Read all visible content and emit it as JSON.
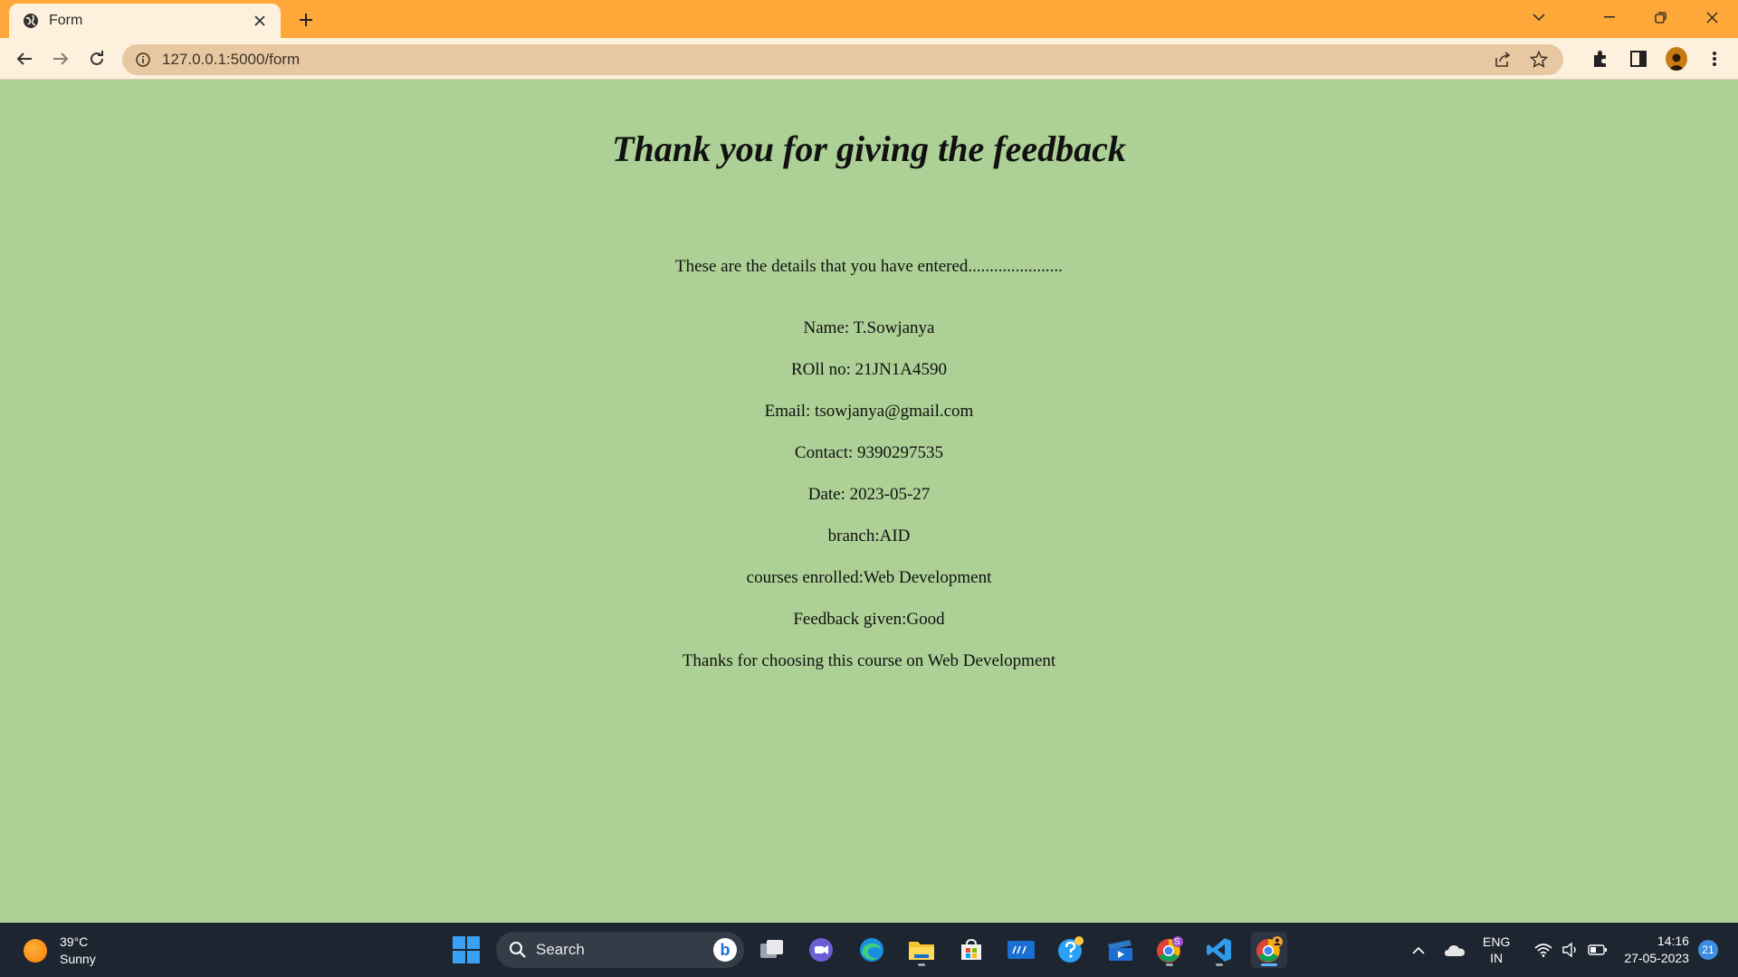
{
  "browser": {
    "tab_title": "Form",
    "url": "127.0.0.1:5000/form",
    "accent": "#ffa83a"
  },
  "page": {
    "background": "#acd095",
    "heading": "Thank you for giving the feedback",
    "intro": "These are the details that you have entered......................",
    "name_line": "Name: T.Sowjanya",
    "roll_line": "ROll no: 21JN1A4590",
    "email_line": "Email: tsowjanya@gmail.com",
    "contact_line": "Contact: 9390297535",
    "date_line": "Date: 2023-05-27",
    "branch_line": "branch:AID",
    "courses_line": "courses enrolled:Web Development",
    "feedback_line": "Feedback given:Good",
    "thanks_line": "Thanks for choosing this course on Web Development"
  },
  "taskbar": {
    "weather_temp": "39°C",
    "weather_desc": "Sunny",
    "search_label": "Search",
    "lang_top": "ENG",
    "lang_bottom": "IN",
    "time": "14:16",
    "date": "27-05-2023",
    "notification_count": "21",
    "chrome_badge": "S"
  }
}
